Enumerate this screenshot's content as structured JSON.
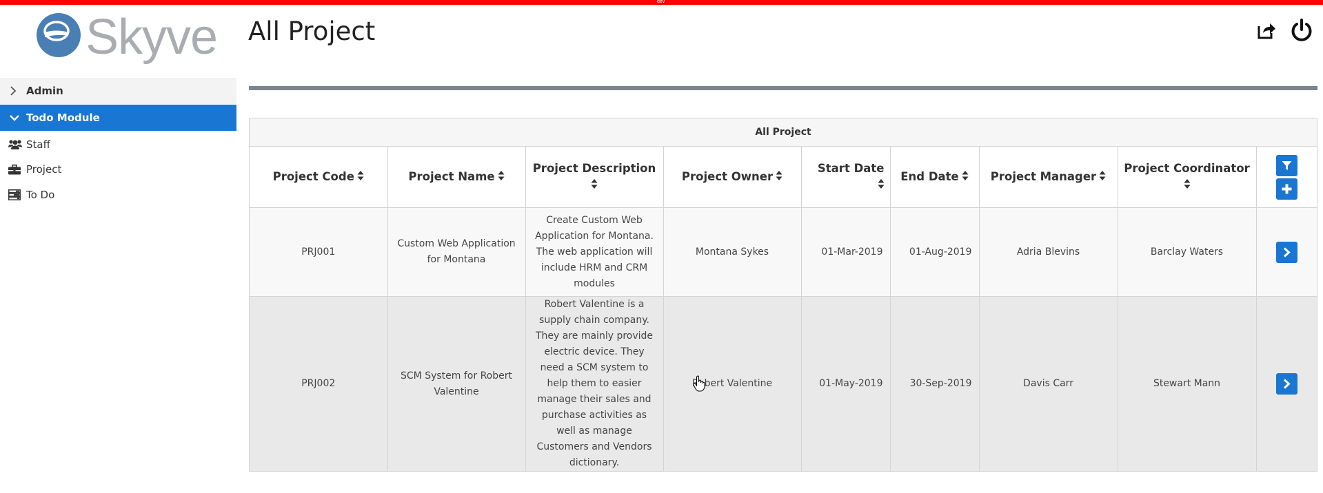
{
  "env_badge": "dev",
  "brand": {
    "name": "Skyve"
  },
  "sidebar": {
    "groups": [
      {
        "label": "Admin",
        "expanded": false
      },
      {
        "label": "Todo Module",
        "expanded": true
      }
    ],
    "items": [
      {
        "label": "Staff",
        "icon": "users-icon"
      },
      {
        "label": "Project",
        "icon": "briefcase-icon"
      },
      {
        "label": "To Do",
        "icon": "tasks-icon"
      }
    ]
  },
  "header": {
    "title": "All Project"
  },
  "grid": {
    "caption": "All Project",
    "columns": [
      "Project Code",
      "Project Name",
      "Project Description",
      "Project Owner",
      "Start Date",
      "End Date",
      "Project Manager",
      "Project Coordinator"
    ],
    "rows": [
      {
        "code": "PRJ001",
        "name": "Custom Web Application for Montana",
        "description": "Create Custom Web Application for Montana. The web application will include HRM and CRM modules",
        "owner": "Montana Sykes",
        "start": "01-Mar-2019",
        "end": "01-Aug-2019",
        "manager": "Adria Blevins",
        "coordinator": "Barclay Waters"
      },
      {
        "code": "PRJ002",
        "name": "SCM System for Robert Valentine",
        "description": "Robert Valentine is a supply chain company. They are mainly provide electric device. They need a SCM system to help them to easier manage their sales and purchase activities as well as manage Customers and Vendors dictionary.",
        "owner": "Robert Valentine",
        "start": "01-May-2019",
        "end": "30-Sep-2019",
        "manager": "Davis Carr",
        "coordinator": "Stewart Mann"
      }
    ]
  },
  "colors": {
    "accent": "#1976d2",
    "dev_bar": "#ff0000",
    "logo_circle": "#4a7fb5",
    "logo_text": "#a9adb2",
    "rule": "#7b8590"
  }
}
